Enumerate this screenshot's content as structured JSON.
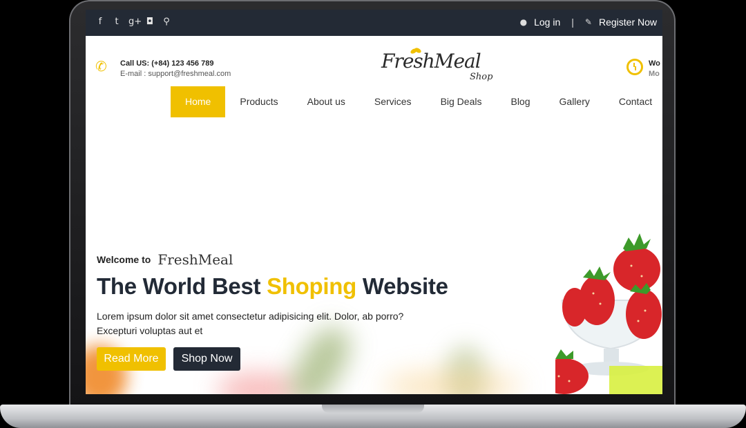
{
  "topbar": {
    "social_icons": [
      "facebook-icon",
      "twitter-icon",
      "google-plus-icon",
      "instagram-icon",
      "search-icon"
    ],
    "social_glyphs": [
      "f",
      "t",
      "g+",
      "◘",
      "⚲"
    ],
    "login_icon": "user-icon",
    "login": "Log in",
    "separator": "|",
    "register_icon": "edit-icon",
    "register": "Register Now"
  },
  "header": {
    "call": "Call US: (+84) 123 456 789",
    "email": "E-mail : support@freshmeal.com",
    "logo_name": "FreshMeal",
    "logo_sub": "Shop",
    "hours_line1": "Wo",
    "hours_line2": "Mo"
  },
  "nav": {
    "items": [
      "Home",
      "Products",
      "About us",
      "Services",
      "Big Deals",
      "Blog",
      "Gallery",
      "Contact"
    ],
    "active": "Home"
  },
  "hero": {
    "welcome": "Welcome to",
    "brand": "FreshMeal",
    "headline_a": "The World Best ",
    "headline_b": "Shoping",
    "headline_c": " Website",
    "desc_line1": "Lorem ipsum dolor sit amet consectetur adipisicing elit. Dolor, ab porro?",
    "desc_line2": "Excepturi voluptas aut et",
    "read_more": "Read More",
    "shop_now": "Shop Now"
  },
  "colors": {
    "accent": "#f0c000",
    "dark": "#232a35"
  }
}
